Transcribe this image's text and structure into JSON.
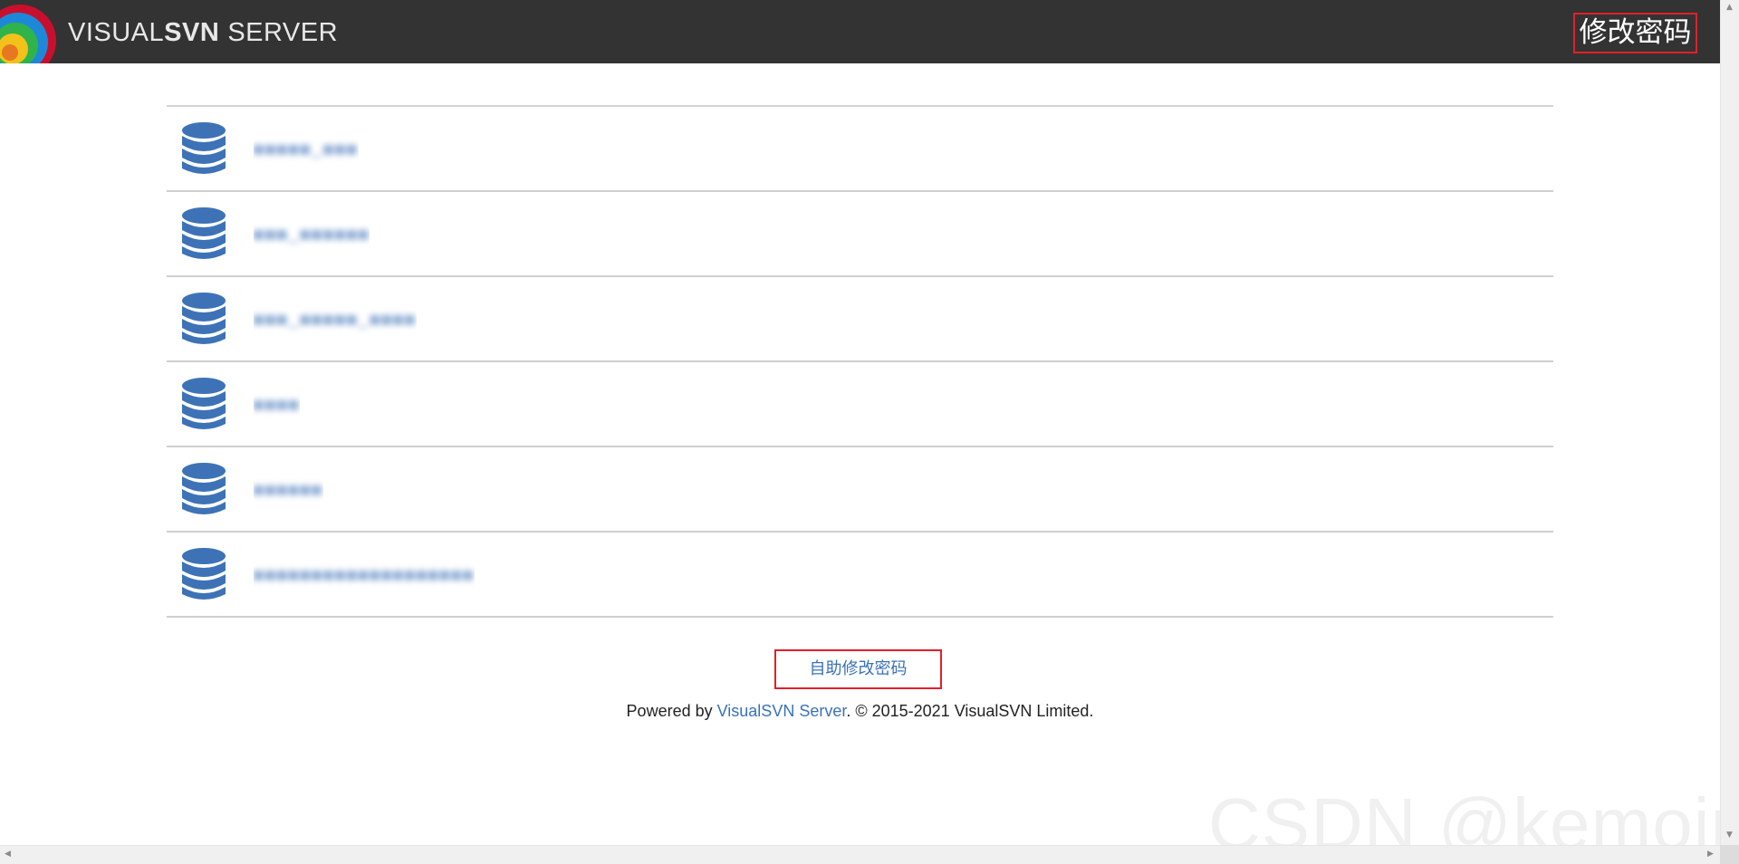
{
  "header": {
    "brand_regular": "VISUAL",
    "brand_bold": "SVN",
    "brand_suffix": "SERVER",
    "change_password_link": "修改密码"
  },
  "repositories": [
    {
      "name": "■■■■■_■■■"
    },
    {
      "name": "■■■_■■■■■■"
    },
    {
      "name": "■■■_■■■■■_■■■■"
    },
    {
      "name": "■■■■"
    },
    {
      "name": "■■■■■■"
    },
    {
      "name": "■■■■■■■■■■■■■■■■■■■"
    }
  ],
  "footer": {
    "self_service_button": "自助修改密码",
    "powered_by_prefix": "Powered by ",
    "powered_by_link": "VisualSVN Server",
    "copyright": ". © 2015-2021 VisualSVN Limited."
  },
  "watermark": "CSDN @kemoing",
  "colors": {
    "header_bg": "#333333",
    "accent_blue": "#3a72b8",
    "highlight_red": "#e0202a"
  }
}
